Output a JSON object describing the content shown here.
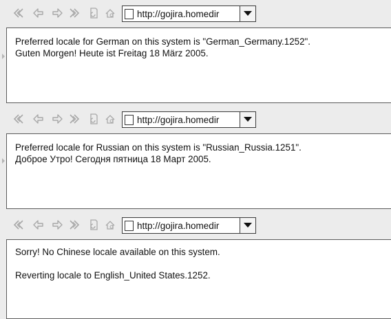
{
  "panels": [
    {
      "url": "http://gojira.homedir",
      "lines": [
        "Preferred locale for German on this system is \"German_Germany.1252\".",
        "Guten Morgen! Heute ist Freitag 18 März 2005."
      ]
    },
    {
      "url": "http://gojira.homedir",
      "lines": [
        "Preferred locale for Russian on this system is \"Russian_Russia.1251\".",
        "Доброе Утро! Сегодня пятница 18 Март 2005."
      ]
    },
    {
      "url": "http://gojira.homedir",
      "lines": [
        "Sorry! No Chinese locale available on this system.",
        "Reverting locale to English_United States.1252."
      ]
    }
  ],
  "icons": {
    "first": "rewind-icon",
    "back": "back-arrow-icon",
    "forward": "forward-arrow-icon",
    "last": "fast-forward-icon",
    "reload": "reload-icon",
    "home": "home-icon",
    "page": "page-icon",
    "dropdown": "dropdown-arrow-icon"
  },
  "colors": {
    "toolbar_bg": "#ececec",
    "icon_gray": "#a8a8a8",
    "content_bg": "#ffffff",
    "text": "#111111"
  }
}
